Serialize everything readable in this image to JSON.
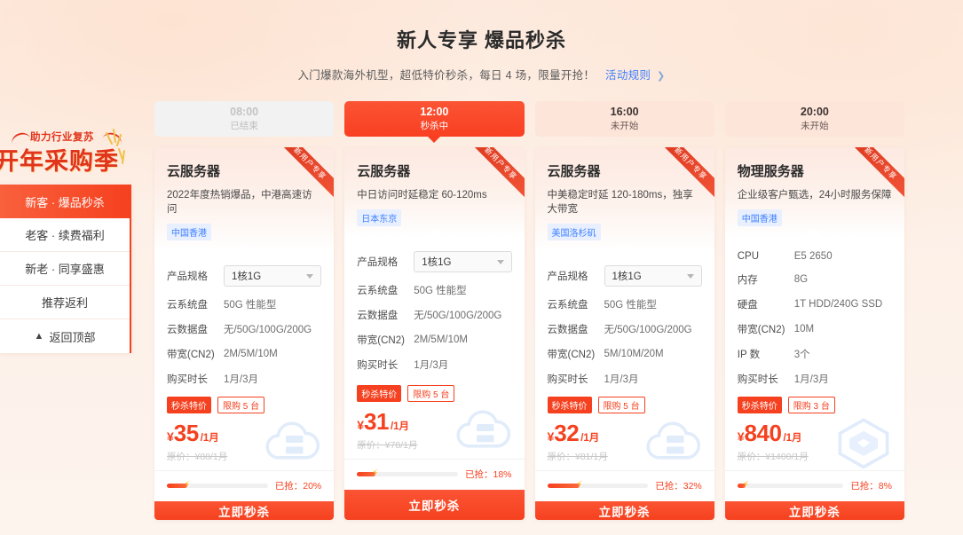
{
  "header": {
    "title": "新人专享 爆品秒杀",
    "subtitle": "入门爆款海外机型，超低特价秒杀，每日 4 场，限量开抢！",
    "rule_link": "活动规则",
    "rule_chevron": "❯"
  },
  "sessions": [
    {
      "time": "08:00",
      "status": "已结束",
      "state": "ended"
    },
    {
      "time": "12:00",
      "status": "秒杀中",
      "state": "active"
    },
    {
      "time": "16:00",
      "status": "未开始",
      "state": "upcoming"
    },
    {
      "time": "20:00",
      "status": "未开始",
      "state": "upcoming"
    }
  ],
  "sidebar": {
    "brand_sub": "助力行业复苏",
    "brand_main": "开年采购季",
    "items": [
      {
        "label": "新客 · 爆品秒杀",
        "active": true
      },
      {
        "label": "老客 · 续费福利",
        "active": false
      },
      {
        "label": "新老 · 同享盛惠",
        "active": false
      },
      {
        "label": "推荐返利",
        "active": false
      }
    ],
    "back_to_top": "返回顶部",
    "back_to_top_icon": "▲"
  },
  "cards": [
    {
      "ribbon": "新用户专享",
      "title": "云服务器",
      "desc": "2022年度热销爆品，中港高速访问",
      "region": "中国香港",
      "watermark": "cloud-server-icon",
      "specs": [
        {
          "label": "产品规格",
          "value": "1核1G",
          "type": "select"
        },
        {
          "label": "云系统盘",
          "value": "50G 性能型",
          "type": "text"
        },
        {
          "label": "云数据盘",
          "value": "无/50G/100G/200G",
          "type": "text"
        },
        {
          "label": "带宽(CN2)",
          "value": "2M/5M/10M",
          "type": "text"
        },
        {
          "label": "购买时长",
          "value": "1月/3月",
          "type": "text"
        }
      ],
      "badge_sale": "秒杀特价",
      "badge_limit": "限购 5 台",
      "currency": "¥",
      "price": "35",
      "unit": "/1月",
      "original_price": "原价：¥88/1月",
      "taken_label": "已抢：20%",
      "progress": 20,
      "buy_label": "立即秒杀"
    },
    {
      "ribbon": "新用户专享",
      "title": "云服务器",
      "desc": "中日访问时延稳定 60-120ms",
      "region": "日本东京",
      "watermark": "cloud-server-icon",
      "specs": [
        {
          "label": "产品规格",
          "value": "1核1G",
          "type": "select"
        },
        {
          "label": "云系统盘",
          "value": "50G 性能型",
          "type": "text"
        },
        {
          "label": "云数据盘",
          "value": "无/50G/100G/200G",
          "type": "text"
        },
        {
          "label": "带宽(CN2)",
          "value": "2M/5M/10M",
          "type": "text"
        },
        {
          "label": "购买时长",
          "value": "1月/3月",
          "type": "text"
        }
      ],
      "badge_sale": "秒杀特价",
      "badge_limit": "限购 5 台",
      "currency": "¥",
      "price": "31",
      "unit": "/1月",
      "original_price": "原价：¥78/1月",
      "taken_label": "已抢：18%",
      "progress": 18,
      "buy_label": "立即秒杀"
    },
    {
      "ribbon": "新用户专享",
      "title": "云服务器",
      "desc": "中美稳定时延 120-180ms，独享大带宽",
      "region": "美国洛杉矶",
      "watermark": "cloud-server-icon",
      "specs": [
        {
          "label": "产品规格",
          "value": "1核1G",
          "type": "select"
        },
        {
          "label": "云系统盘",
          "value": "50G 性能型",
          "type": "text"
        },
        {
          "label": "云数据盘",
          "value": "无/50G/100G/200G",
          "type": "text"
        },
        {
          "label": "带宽(CN2)",
          "value": "5M/10M/20M",
          "type": "text"
        },
        {
          "label": "购买时长",
          "value": "1月/3月",
          "type": "text"
        }
      ],
      "badge_sale": "秒杀特价",
      "badge_limit": "限购 5 台",
      "currency": "¥",
      "price": "32",
      "unit": "/1月",
      "original_price": "原价：¥81/1月",
      "taken_label": "已抢：32%",
      "progress": 32,
      "buy_label": "立即秒杀"
    },
    {
      "ribbon": "新用户专享",
      "title": "物理服务器",
      "desc": "企业级客户甄选，24小时服务保障",
      "region": "中国香港",
      "watermark": "hexagon-icon",
      "specs": [
        {
          "label": "CPU",
          "value": "E5 2650",
          "type": "text"
        },
        {
          "label": "内存",
          "value": "8G",
          "type": "text"
        },
        {
          "label": "硬盘",
          "value": "1T HDD/240G SSD",
          "type": "text"
        },
        {
          "label": "带宽(CN2)",
          "value": "10M",
          "type": "text"
        },
        {
          "label": "IP 数",
          "value": "3个",
          "type": "text"
        },
        {
          "label": "购买时长",
          "value": "1月/3月",
          "type": "text"
        }
      ],
      "badge_sale": "秒杀特价",
      "badge_limit": "限购 3 台",
      "currency": "¥",
      "price": "840",
      "unit": "/1月",
      "original_price": "原价：¥1400/1月",
      "taken_label": "已抢：8%",
      "progress": 8,
      "buy_label": "立即秒杀"
    }
  ],
  "colors": {
    "accent": "#f5411f",
    "link": "#3d7fff",
    "background": "#fdf0e7",
    "tag_bg": "#e8efff"
  }
}
